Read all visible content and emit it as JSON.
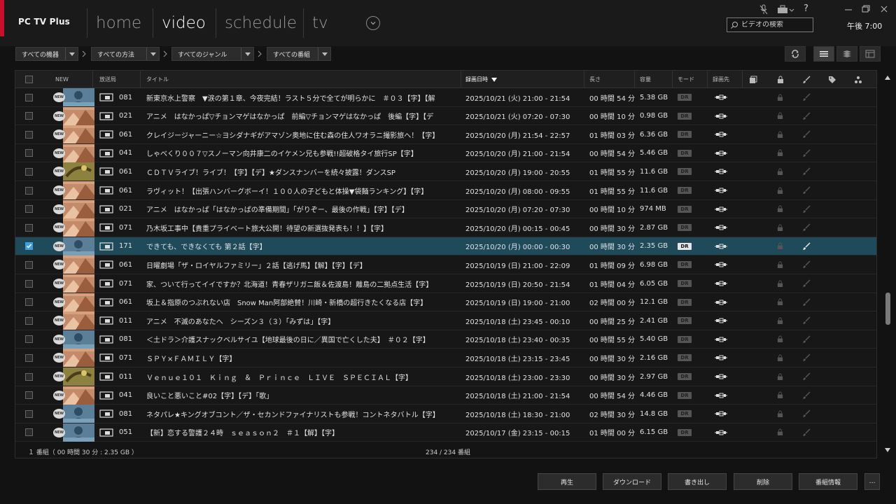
{
  "app": {
    "title": "PC TV Plus"
  },
  "nav": {
    "tabs": [
      {
        "label": "home"
      },
      {
        "label": "video",
        "active": true
      },
      {
        "label": "schedule"
      },
      {
        "label": "tv"
      }
    ]
  },
  "search": {
    "placeholder": "ビデオの検索"
  },
  "clock": "午後 7:00",
  "filters": [
    "すべての機器",
    "すべての方法",
    "すべてのジャンル",
    "すべての番組"
  ],
  "table": {
    "headers": {
      "new": "NEW",
      "station": "放送局",
      "title": "タイトル",
      "date": "録画日時",
      "length": "長さ",
      "size": "容量",
      "mode": "モード",
      "dest": "録画先"
    },
    "rows": [
      {
        "ch": "081",
        "title": "新東京水上警察　▼涙の第１章、今夜完結！ラスト５分で全てが明らかに　＃０３【字】【解",
        "date": "2025/10/21 (火) 21:00 - 21:54",
        "len": "00 時間 54 分",
        "size": "5.38 GB",
        "mode": "DR",
        "selected": false,
        "thumb": "blue"
      },
      {
        "ch": "021",
        "title": "アニメ　はなかっぱ▽チョンマゲはなかっぱ　前編▽チョンマゲはなかっぱ　後編【字】【デ",
        "date": "2025/10/21 (火) 07:20 - 07:30",
        "len": "00 時間 10 分",
        "size": "0.98 GB",
        "mode": "DR",
        "selected": false,
        "thumb": "orange"
      },
      {
        "ch": "061",
        "title": "クレイジージャーニー☆ヨシダナギがアマゾン奥地に住む森の住人ワオラニ撮影旅へ！【字】",
        "date": "2025/10/20 (月) 21:54 - 22:57",
        "len": "01 時間 03 分",
        "size": "6.36 GB",
        "mode": "DR",
        "selected": false,
        "thumb": "orange"
      },
      {
        "ch": "041",
        "title": "しゃべくり００７▽スノーマン向井康二のイケメン兄も参戦!!超破格タイ旅行SP【字】",
        "date": "2025/10/20 (月) 21:00 - 21:54",
        "len": "00 時間 54 分",
        "size": "5.46 GB",
        "mode": "DR",
        "selected": false,
        "thumb": "orange"
      },
      {
        "ch": "061",
        "title": "ＣＤＴＶライブ！ライブ！【字】【デ】★ダンスナンバーを続々披露！ダンスSP",
        "date": "2025/10/20 (月) 19:00 - 20:55",
        "len": "01 時間 55 分",
        "size": "11.6 GB",
        "mode": "DR",
        "selected": false,
        "thumb": "olive"
      },
      {
        "ch": "061",
        "title": "ラヴィット！【出張ハンバーグボーイ！１００人の子どもと体操▼袋麺ランキング】【字】",
        "date": "2025/10/20 (月) 08:00 - 09:55",
        "len": "01 時間 55 分",
        "size": "11.6 GB",
        "mode": "DR",
        "selected": false,
        "thumb": "orange"
      },
      {
        "ch": "021",
        "title": "アニメ　はなかっぱ「はなかっぱの準備期間」「がりぞー、最後の作戦」【字】【デ】",
        "date": "2025/10/20 (月) 07:20 - 07:30",
        "len": "00 時間 10 分",
        "size": "974 MB",
        "mode": "DR",
        "selected": false,
        "thumb": "orange"
      },
      {
        "ch": "071",
        "title": "乃木坂工事中【貴重プライベート旅大公開！待望の新選抜発表も！！】【字】",
        "date": "2025/10/20 (月) 00:15 - 00:45",
        "len": "00 時間 30 分",
        "size": "2.87 GB",
        "mode": "DR",
        "selected": false,
        "thumb": "orange"
      },
      {
        "ch": "171",
        "title": "できても、できなくても 第２話【字】",
        "date": "2025/10/20 (月) 00:00 - 00:30",
        "len": "00 時間 30 分",
        "size": "2.35 GB",
        "mode": "DR",
        "selected": true,
        "thumb": "blue"
      },
      {
        "ch": "061",
        "title": "日曜劇場「ザ・ロイヤルファミリー」２話【逃げ馬】【解】【字】【デ】",
        "date": "2025/10/19 (日) 21:00 - 22:09",
        "len": "01 時間 09 分",
        "size": "6.98 GB",
        "mode": "DR",
        "selected": false,
        "thumb": "orange"
      },
      {
        "ch": "071",
        "title": "家、ついて行ってイイですか？北海道！青春ザリガニ飯＆佐渡島！離島の二拠点生活【字】",
        "date": "2025/10/19 (日) 20:50 - 21:54",
        "len": "01 時間 04 分",
        "size": "6.05 GB",
        "mode": "DR",
        "selected": false,
        "thumb": "orange"
      },
      {
        "ch": "061",
        "title": "坂上＆指原のつぶれない店　Snow Man阿部絶賛！川崎・新橋の超行きたくなる店【字】",
        "date": "2025/10/19 (日) 19:00 - 21:00",
        "len": "02 時間 00 分",
        "size": "12.1 GB",
        "mode": "DR",
        "selected": false,
        "thumb": "orange"
      },
      {
        "ch": "011",
        "title": "アニメ　不滅のあなたへ　シーズン３（３）「みずは」【字】",
        "date": "2025/10/18 (土) 23:45 - 00:10",
        "len": "00 時間 25 分",
        "size": "2.41 GB",
        "mode": "DR",
        "selected": false,
        "thumb": "orange"
      },
      {
        "ch": "081",
        "title": "＜土ドラ＞介護スナックベルサイユ【地球最後の日に／異国で亡くした夫】　＃０２【字】",
        "date": "2025/10/18 (土) 23:40 - 00:35",
        "len": "00 時間 55 分",
        "size": "5.40 GB",
        "mode": "DR",
        "selected": false,
        "thumb": "blue"
      },
      {
        "ch": "071",
        "title": "ＳＰＹ×ＦＡＭＩＬＹ【字】",
        "date": "2025/10/18 (土) 23:15 - 23:45",
        "len": "00 時間 30 分",
        "size": "2.16 GB",
        "mode": "DR",
        "selected": false,
        "thumb": "orange"
      },
      {
        "ch": "011",
        "title": "Ｖｅｎｕｅ１０１　Ｋｉｎｇ　＆　Ｐｒｉｎｃｅ　ＬＩＶＥ　ＳＰＥＣＩＡＬ【字】",
        "date": "2025/10/18 (土) 23:00 - 23:30",
        "len": "00 時間 30 分",
        "size": "2.97 GB",
        "mode": "DR",
        "selected": false,
        "thumb": "olive"
      },
      {
        "ch": "041",
        "title": "良いこと悪いこと#02【字】【デ】「歌」",
        "date": "2025/10/18 (土) 21:00 - 21:54",
        "len": "00 時間 54 分",
        "size": "4.46 GB",
        "mode": "DR",
        "selected": false,
        "thumb": "orange"
      },
      {
        "ch": "081",
        "title": "ネタパレ★キングオブコント／ザ・セカンドファイナリストも参戦！コントネタバトル【字】",
        "date": "2025/10/18 (土) 18:30 - 21:00",
        "len": "02 時間 30 分",
        "size": "14.8 GB",
        "mode": "DR",
        "selected": false,
        "thumb": "blue"
      },
      {
        "ch": "051",
        "title": "【新】恋する警護２４時　ｓｅａｓｏｎ２　＃１【解】【字】",
        "date": "2025/10/17 (金) 23:15 - 00:15",
        "len": "01 時間 00 分",
        "size": "6.15 GB",
        "mode": "DR",
        "selected": false,
        "thumb": "blue"
      }
    ]
  },
  "footer": {
    "selection_info": "１ 番組（ 00 時間 30 分 : 2.35 GB ）",
    "count": "234 / 234 番組"
  },
  "actions": [
    "再生",
    "ダウンロード",
    "書き出し",
    "削除",
    "番組情報",
    "…"
  ],
  "colors": {
    "accent_red": "#c8102e",
    "selected_row": "#1e4a5a",
    "check_blue": "#3ea0e0"
  }
}
